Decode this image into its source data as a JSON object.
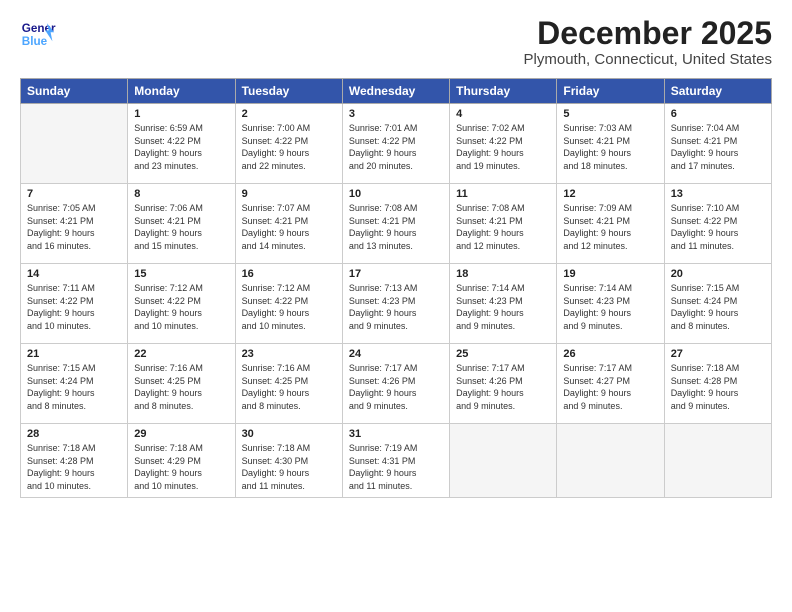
{
  "header": {
    "logo_line1": "General",
    "logo_line2": "Blue",
    "month_title": "December 2025",
    "location": "Plymouth, Connecticut, United States"
  },
  "days_of_week": [
    "Sunday",
    "Monday",
    "Tuesday",
    "Wednesday",
    "Thursday",
    "Friday",
    "Saturday"
  ],
  "weeks": [
    [
      {
        "day": "",
        "info": ""
      },
      {
        "day": "1",
        "info": "Sunrise: 6:59 AM\nSunset: 4:22 PM\nDaylight: 9 hours\nand 23 minutes."
      },
      {
        "day": "2",
        "info": "Sunrise: 7:00 AM\nSunset: 4:22 PM\nDaylight: 9 hours\nand 22 minutes."
      },
      {
        "day": "3",
        "info": "Sunrise: 7:01 AM\nSunset: 4:22 PM\nDaylight: 9 hours\nand 20 minutes."
      },
      {
        "day": "4",
        "info": "Sunrise: 7:02 AM\nSunset: 4:22 PM\nDaylight: 9 hours\nand 19 minutes."
      },
      {
        "day": "5",
        "info": "Sunrise: 7:03 AM\nSunset: 4:21 PM\nDaylight: 9 hours\nand 18 minutes."
      },
      {
        "day": "6",
        "info": "Sunrise: 7:04 AM\nSunset: 4:21 PM\nDaylight: 9 hours\nand 17 minutes."
      }
    ],
    [
      {
        "day": "7",
        "info": "Sunrise: 7:05 AM\nSunset: 4:21 PM\nDaylight: 9 hours\nand 16 minutes."
      },
      {
        "day": "8",
        "info": "Sunrise: 7:06 AM\nSunset: 4:21 PM\nDaylight: 9 hours\nand 15 minutes."
      },
      {
        "day": "9",
        "info": "Sunrise: 7:07 AM\nSunset: 4:21 PM\nDaylight: 9 hours\nand 14 minutes."
      },
      {
        "day": "10",
        "info": "Sunrise: 7:08 AM\nSunset: 4:21 PM\nDaylight: 9 hours\nand 13 minutes."
      },
      {
        "day": "11",
        "info": "Sunrise: 7:08 AM\nSunset: 4:21 PM\nDaylight: 9 hours\nand 12 minutes."
      },
      {
        "day": "12",
        "info": "Sunrise: 7:09 AM\nSunset: 4:21 PM\nDaylight: 9 hours\nand 12 minutes."
      },
      {
        "day": "13",
        "info": "Sunrise: 7:10 AM\nSunset: 4:22 PM\nDaylight: 9 hours\nand 11 minutes."
      }
    ],
    [
      {
        "day": "14",
        "info": "Sunrise: 7:11 AM\nSunset: 4:22 PM\nDaylight: 9 hours\nand 10 minutes."
      },
      {
        "day": "15",
        "info": "Sunrise: 7:12 AM\nSunset: 4:22 PM\nDaylight: 9 hours\nand 10 minutes."
      },
      {
        "day": "16",
        "info": "Sunrise: 7:12 AM\nSunset: 4:22 PM\nDaylight: 9 hours\nand 10 minutes."
      },
      {
        "day": "17",
        "info": "Sunrise: 7:13 AM\nSunset: 4:23 PM\nDaylight: 9 hours\nand 9 minutes."
      },
      {
        "day": "18",
        "info": "Sunrise: 7:14 AM\nSunset: 4:23 PM\nDaylight: 9 hours\nand 9 minutes."
      },
      {
        "day": "19",
        "info": "Sunrise: 7:14 AM\nSunset: 4:23 PM\nDaylight: 9 hours\nand 9 minutes."
      },
      {
        "day": "20",
        "info": "Sunrise: 7:15 AM\nSunset: 4:24 PM\nDaylight: 9 hours\nand 8 minutes."
      }
    ],
    [
      {
        "day": "21",
        "info": "Sunrise: 7:15 AM\nSunset: 4:24 PM\nDaylight: 9 hours\nand 8 minutes."
      },
      {
        "day": "22",
        "info": "Sunrise: 7:16 AM\nSunset: 4:25 PM\nDaylight: 9 hours\nand 8 minutes."
      },
      {
        "day": "23",
        "info": "Sunrise: 7:16 AM\nSunset: 4:25 PM\nDaylight: 9 hours\nand 8 minutes."
      },
      {
        "day": "24",
        "info": "Sunrise: 7:17 AM\nSunset: 4:26 PM\nDaylight: 9 hours\nand 9 minutes."
      },
      {
        "day": "25",
        "info": "Sunrise: 7:17 AM\nSunset: 4:26 PM\nDaylight: 9 hours\nand 9 minutes."
      },
      {
        "day": "26",
        "info": "Sunrise: 7:17 AM\nSunset: 4:27 PM\nDaylight: 9 hours\nand 9 minutes."
      },
      {
        "day": "27",
        "info": "Sunrise: 7:18 AM\nSunset: 4:28 PM\nDaylight: 9 hours\nand 9 minutes."
      }
    ],
    [
      {
        "day": "28",
        "info": "Sunrise: 7:18 AM\nSunset: 4:28 PM\nDaylight: 9 hours\nand 10 minutes."
      },
      {
        "day": "29",
        "info": "Sunrise: 7:18 AM\nSunset: 4:29 PM\nDaylight: 9 hours\nand 10 minutes."
      },
      {
        "day": "30",
        "info": "Sunrise: 7:18 AM\nSunset: 4:30 PM\nDaylight: 9 hours\nand 11 minutes."
      },
      {
        "day": "31",
        "info": "Sunrise: 7:19 AM\nSunset: 4:31 PM\nDaylight: 9 hours\nand 11 minutes."
      },
      {
        "day": "",
        "info": ""
      },
      {
        "day": "",
        "info": ""
      },
      {
        "day": "",
        "info": ""
      }
    ]
  ]
}
